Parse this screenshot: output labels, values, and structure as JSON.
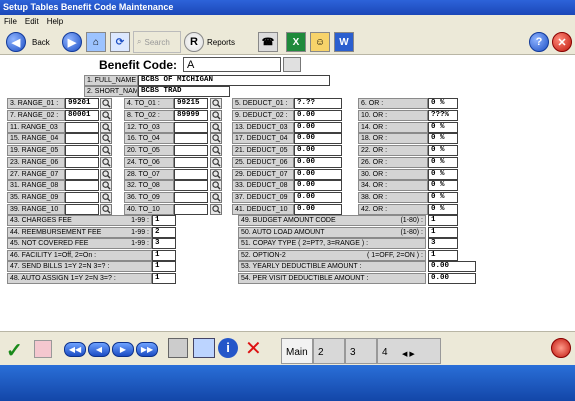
{
  "window": {
    "title": "Setup Tables Benefit Code Maintenance"
  },
  "menu": [
    "File",
    "Edit",
    "Help"
  ],
  "toolbar": {
    "back": "Back",
    "search": "Search",
    "reports": "Reports"
  },
  "benefit_code": {
    "label": "Benefit Code:",
    "value": "A"
  },
  "names": [
    {
      "label": "1. FULL_NAME :",
      "value": "BCBS OF MICHIGAN"
    },
    {
      "label": "2. SHORT_NAME",
      "value": "BCBS TRAD"
    }
  ],
  "ranges_a": [
    {
      "label": "3. RANGE_01 :",
      "value": "99201"
    },
    {
      "label": "7. RANGE_02 :",
      "value": "80001"
    },
    {
      "label": "11. RANGE_03",
      "value": ""
    },
    {
      "label": "15. RANGE_04",
      "value": ""
    },
    {
      "label": "19. RANGE_05",
      "value": ""
    },
    {
      "label": "23. RANGE_06",
      "value": ""
    },
    {
      "label": "27. RANGE_07",
      "value": ""
    },
    {
      "label": "31. RANGE_08",
      "value": ""
    },
    {
      "label": "35. RANGE_09",
      "value": ""
    },
    {
      "label": "39. RANGE_10",
      "value": ""
    }
  ],
  "ranges_b": [
    {
      "label": "4. TO_01 :",
      "value": "99215"
    },
    {
      "label": "8. TO_02 :",
      "value": "89999"
    },
    {
      "label": "12. TO_03",
      "value": ""
    },
    {
      "label": "16. TO_04",
      "value": ""
    },
    {
      "label": "20. TO_05",
      "value": ""
    },
    {
      "label": "24. TO_06",
      "value": ""
    },
    {
      "label": "28. TO_07",
      "value": ""
    },
    {
      "label": "32. TO_08",
      "value": ""
    },
    {
      "label": "36. TO_09",
      "value": ""
    },
    {
      "label": "40. TO_10",
      "value": ""
    }
  ],
  "deducts": [
    {
      "label": "5. DEDUCT_01 :",
      "value": "?.??"
    },
    {
      "label": "9. DEDUCT_02 :",
      "value": "0.00"
    },
    {
      "label": "13. DEDUCT_03",
      "value": "0.00"
    },
    {
      "label": "17. DEDUCT_04",
      "value": "0.00"
    },
    {
      "label": "21. DEDUCT_05",
      "value": "0.00"
    },
    {
      "label": "25. DEDUCT_06",
      "value": "0.00"
    },
    {
      "label": "29. DEDUCT_07",
      "value": "0.00"
    },
    {
      "label": "33. DEDUCT_08",
      "value": "0.00"
    },
    {
      "label": "37. DEDUCT_09",
      "value": "0.00"
    },
    {
      "label": "41. DEDUCT_10",
      "value": "0.00"
    }
  ],
  "ors": [
    {
      "label": "6. OR :",
      "value": "0 %"
    },
    {
      "label": "10. OR :",
      "value": "???%"
    },
    {
      "label": "14. OR :",
      "value": "0 %"
    },
    {
      "label": "18. OR :",
      "value": "0 %"
    },
    {
      "label": "22. OR :",
      "value": "0 %"
    },
    {
      "label": "26. OR :",
      "value": "0 %"
    },
    {
      "label": "30. OR :",
      "value": "0 %"
    },
    {
      "label": "34. OR :",
      "value": "0 %"
    },
    {
      "label": "38. OR :",
      "value": "0 %"
    },
    {
      "label": "42. OR :",
      "value": "0 %"
    }
  ],
  "fees_left": [
    {
      "label": "43. CHARGES FEE",
      "range": "1-99 :",
      "value": "1"
    },
    {
      "label": "44. REEMBURSEMENT FEE",
      "range": "1-99 :",
      "value": "2"
    },
    {
      "label": "45. NOT COVERED FEE",
      "range": "1-99 :",
      "value": "3"
    },
    {
      "label": "46. FACILITY   1=Off, 2=On :",
      "range": "",
      "value": "1"
    },
    {
      "label": "47. SEND BILLS  1=Y 2=N 3=? :",
      "range": "",
      "value": "1"
    },
    {
      "label": "48. AUTO ASSIGN 1=Y 2=N 3=? :",
      "range": "",
      "value": "1"
    }
  ],
  "fees_right": [
    {
      "label": "49. BUDGET AMOUNT CODE",
      "range": "(1-80) :",
      "value": "1"
    },
    {
      "label": "50. AUTO LOAD AMOUNT",
      "range": "(1-80) :",
      "value": "1"
    },
    {
      "label": "51. COPAY TYPE ( 2=PT?, 3=RANGE ) :",
      "range": "",
      "value": "3"
    },
    {
      "label": "52. OPTION-2",
      "range": "( 1=OFF, 2=ON ) :",
      "value": "1"
    },
    {
      "label": "53. YEARLY DEDUCTIBLE AMOUNT :",
      "range": "",
      "value": "0.00"
    },
    {
      "label": "54. PER VISIT DEDUCTIBLE AMOUNT :",
      "range": "",
      "value": "0.00"
    }
  ],
  "tabs": [
    "Main",
    "2",
    "3",
    "4"
  ],
  "colors": {
    "title": "#1b47b8",
    "status": "#1346a8"
  }
}
